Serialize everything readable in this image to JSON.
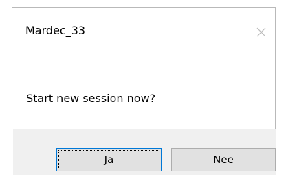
{
  "dialog": {
    "title": "Mardec_33",
    "close_icon": "close-icon",
    "message": "Start new session now?",
    "buttons": {
      "yes": {
        "mnemonic": "J",
        "rest": "a"
      },
      "no": {
        "mnemonic": "N",
        "rest": "ee"
      }
    },
    "colors": {
      "footer_bg": "#f0f0f0",
      "button_bg": "#e1e1e1",
      "default_button_border": "#0078d7"
    }
  }
}
